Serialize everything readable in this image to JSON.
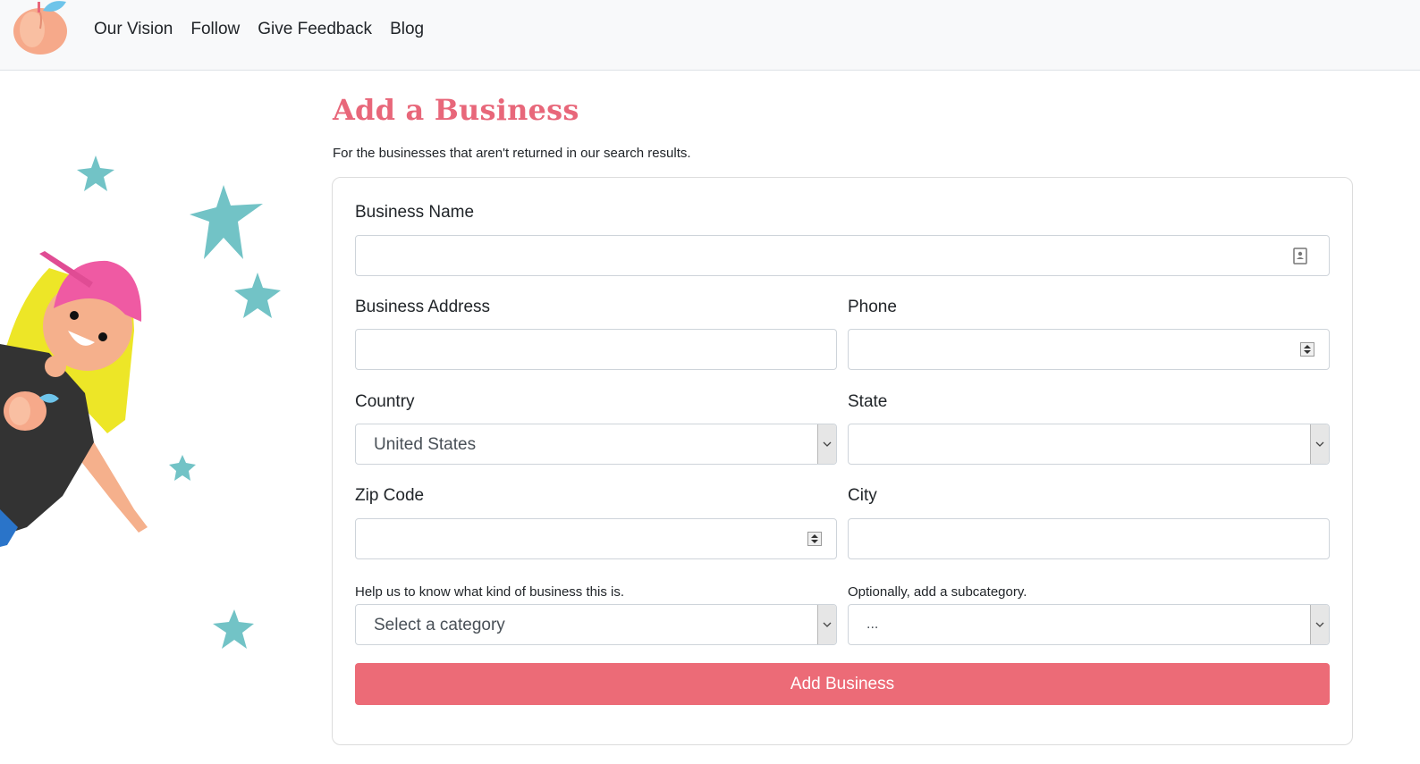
{
  "nav": {
    "links": [
      "Our Vision",
      "Follow",
      "Give Feedback",
      "Blog"
    ]
  },
  "page": {
    "title": "Add a Business",
    "subtitle": "For the businesses that aren't returned in our search results."
  },
  "form": {
    "business_name": {
      "label": "Business Name",
      "value": ""
    },
    "business_address": {
      "label": "Business Address",
      "value": ""
    },
    "phone": {
      "label": "Phone",
      "value": ""
    },
    "country": {
      "label": "Country",
      "selected": "United States"
    },
    "state": {
      "label": "State",
      "selected": ""
    },
    "zip_code": {
      "label": "Zip Code",
      "value": ""
    },
    "city": {
      "label": "City",
      "value": ""
    },
    "category": {
      "label": "Help us to know what kind of business this is.",
      "selected": "Select a category"
    },
    "subcategory": {
      "label": "Optionally, add a subcategory.",
      "selected": "..."
    },
    "submit_label": "Add Business"
  },
  "colors": {
    "accent": "#e8677a",
    "button": "#ec6b77",
    "star": "#72c3c6",
    "navbar_bg": "#f8f9fa"
  },
  "icons": [
    "peach-logo-icon",
    "contact-card-icon",
    "number-spinner-icon",
    "chevron-down-icon"
  ]
}
